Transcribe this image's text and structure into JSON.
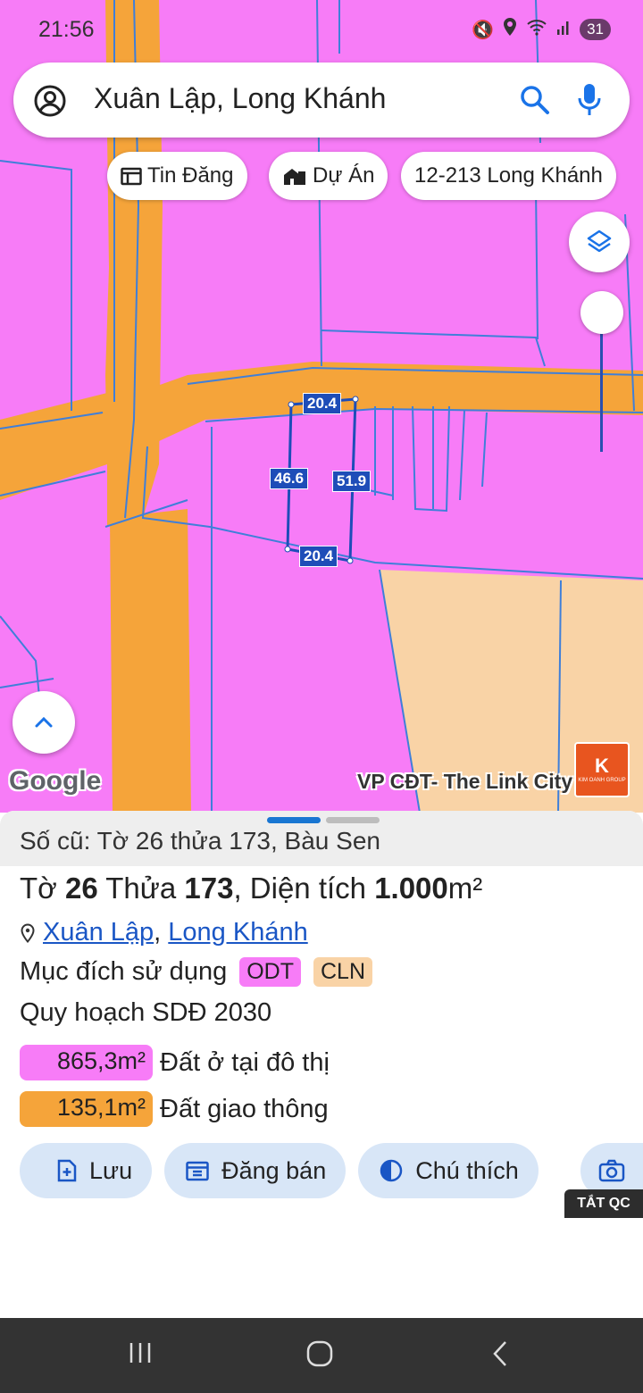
{
  "status_bar": {
    "time": "21:56",
    "battery": "31"
  },
  "search": {
    "query": "Xuân Lập, Long Khánh"
  },
  "chips": [
    {
      "label": "Tin Đăng",
      "icon": "listing-icon"
    },
    {
      "label": "Dự Án",
      "icon": "project-icon"
    },
    {
      "label": "12-213 Long Khánh",
      "icon": ""
    }
  ],
  "map": {
    "parcel_dimensions": {
      "top": "20.4",
      "left": "46.6",
      "right": "51.9",
      "bottom": "20.4"
    },
    "attribution": "Google",
    "poi_label": "VP CĐT- The Link City",
    "logo_text": "K",
    "logo_caption": "KIM OANH GROUP",
    "colors": {
      "residential": "#f77cf7",
      "road": "#f5a43a",
      "other_land": "#f9d3a6",
      "boundary": "#3f7fd9",
      "dimension_label": "#1e4db8"
    }
  },
  "sheet": {
    "old_info": "Số cũ: Tờ 26 thửa 173, Bàu Sen",
    "title": {
      "to_prefix": "Tờ ",
      "to_num": "26",
      "thua_prefix": " Thửa ",
      "thua_num": "173",
      "area_prefix": ", Diện tích ",
      "area_num": "1.000",
      "area_unit": "m²"
    },
    "location": {
      "ward": "Xuân Lập",
      "separator": ",",
      "city": "Long Khánh"
    },
    "purpose_label": "Mục đích sử dụng",
    "purpose_tags": [
      {
        "code": "ODT",
        "color": "#f77cf7"
      },
      {
        "code": "CLN",
        "color": "#f9d3a6"
      }
    ],
    "plan_label": "Quy hoạch SDĐ 2030",
    "zones": [
      {
        "area": "865,3m²",
        "name": "Đất ở tại đô thị",
        "color": "#f77cf7"
      },
      {
        "area": "135,1m²",
        "name": "Đất giao thông",
        "color": "#f5a43a"
      }
    ],
    "actions": [
      {
        "label": "Lưu",
        "icon": "save-icon"
      },
      {
        "label": "Đăng bán",
        "icon": "post-sale-icon"
      },
      {
        "label": "Chú thích",
        "icon": "legend-icon"
      }
    ],
    "ads_off_label": "TẮT QC"
  }
}
